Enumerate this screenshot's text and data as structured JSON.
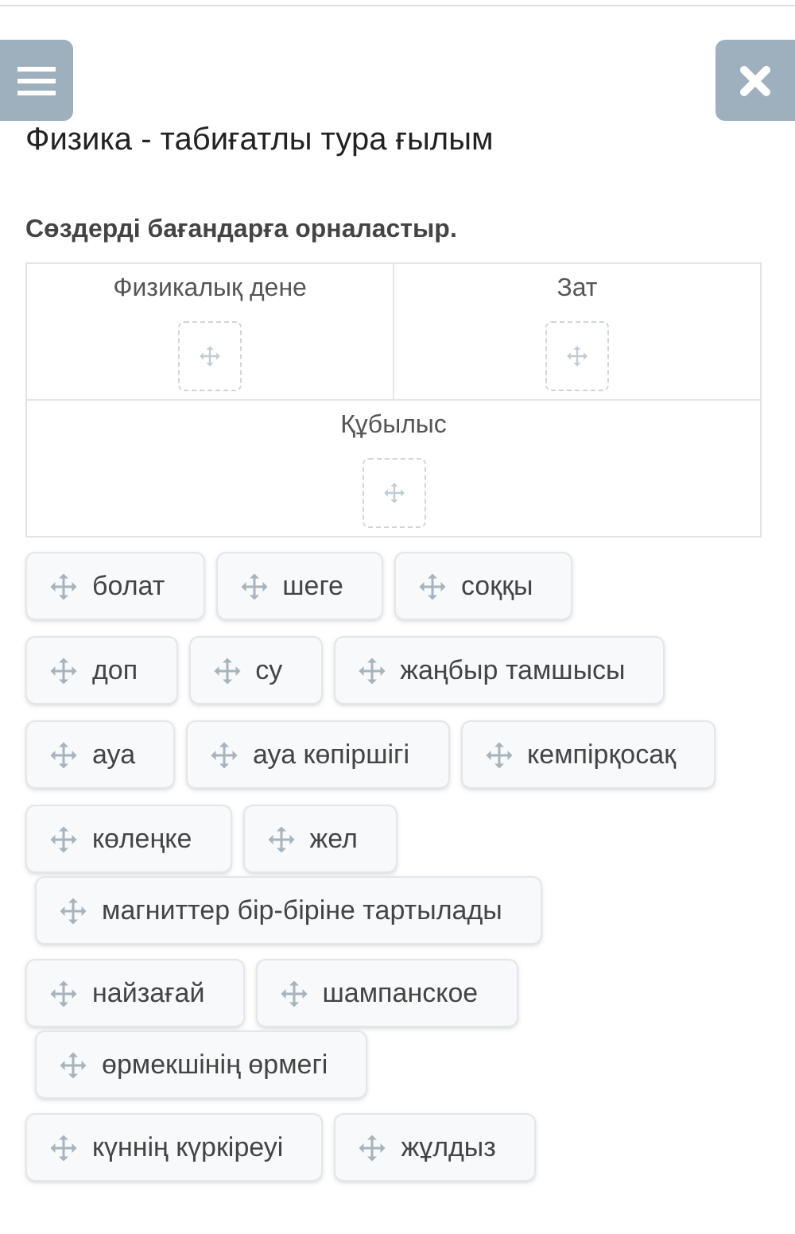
{
  "title": "Физика - табиғатлы тура ғылым",
  "instruction": "Сөздерді бағандарға орналастыр.",
  "table": {
    "rows": [
      [
        {
          "heading": "Физикалық дене"
        },
        {
          "heading": "Зат"
        }
      ],
      [
        {
          "heading": "Құбылыс"
        }
      ]
    ]
  },
  "word_rows": [
    {
      "continued": false,
      "words": [
        "болат",
        "шеге",
        "соққы"
      ]
    },
    {
      "continued": false,
      "words": [
        "доп",
        "су",
        "жаңбыр тамшысы"
      ]
    },
    {
      "continued": false,
      "words": [
        "ауа",
        "ауа көпіршігі",
        "кемпірқосақ"
      ]
    },
    {
      "continued": false,
      "words": [
        "көлеңке",
        "жел"
      ]
    },
    {
      "continued": true,
      "words": [
        "магниттер бір-біріне тартылады"
      ]
    },
    {
      "continued": false,
      "words": [
        "найзағай",
        "шампанское"
      ]
    },
    {
      "continued": true,
      "words": [
        "өрмекшінің өрмегі"
      ]
    },
    {
      "continued": false,
      "words": [
        "күннің күркіреуі",
        "жұлдыз"
      ]
    }
  ]
}
